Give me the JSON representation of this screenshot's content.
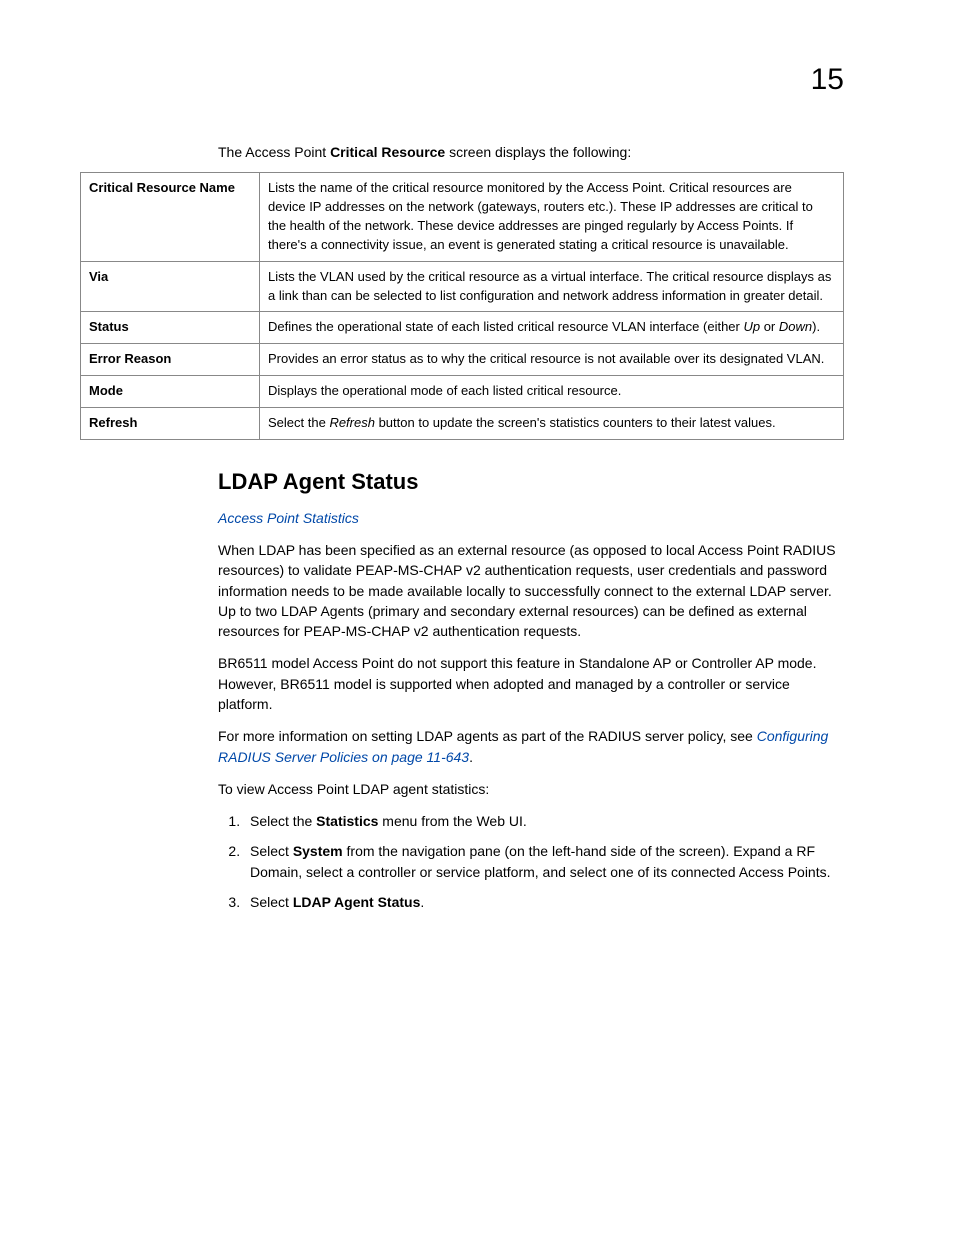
{
  "page_number": "15",
  "intro": {
    "prefix": "The Access Point ",
    "bold": "Critical Resource",
    "suffix": " screen displays the following:"
  },
  "table": [
    {
      "label": "Critical Resource Name",
      "desc": "Lists the name of the critical resource monitored by the Access Point. Critical resources are device IP addresses on the network (gateways, routers etc.). These IP addresses are critical to the health of the network. These device addresses are pinged regularly by Access Points. If there's a connectivity issue, an event is generated stating a critical resource is unavailable."
    },
    {
      "label": "Via",
      "desc": "Lists the VLAN used by the critical resource as a virtual interface. The critical resource displays as a link than can be selected to list configuration and network address information in greater detail."
    },
    {
      "label": "Status",
      "desc_pre": "Defines the operational state of each listed critical resource VLAN interface (either ",
      "ital1": "Up",
      "mid": " or ",
      "ital2": "Down",
      "desc_post": ")."
    },
    {
      "label": "Error Reason",
      "desc": "Provides an error status as to why the critical resource is not available over its designated VLAN."
    },
    {
      "label": "Mode",
      "desc": "Displays the operational mode of each listed critical resource."
    },
    {
      "label": "Refresh",
      "desc_pre": "Select the ",
      "ital1": "Refresh",
      "desc_post": " button to update the screen's statistics counters to their latest values."
    }
  ],
  "section_heading": "LDAP Agent Status",
  "breadcrumb_link": "Access Point Statistics",
  "para1": "When LDAP has been specified as an external resource (as opposed to local Access Point RADIUS resources) to validate PEAP-MS-CHAP v2 authentication requests, user credentials and password information needs to be made available locally to successfully connect to the external LDAP server. Up to two LDAP Agents (primary and secondary external resources) can be defined as external resources for PEAP-MS-CHAP v2 authentication requests.",
  "para2": "BR6511 model Access Point do not support this feature in Standalone AP or Controller AP mode. However, BR6511 model is supported when adopted and managed by a controller or service platform.",
  "para3_pre": "For more information on setting LDAP agents as part of the RADIUS server policy, see ",
  "para3_link": "Configuring RADIUS Server Policies on page 11-643",
  "para3_post": ".",
  "para4": "To view Access Point LDAP agent statistics:",
  "steps": {
    "s1_pre": "Select the ",
    "s1_bold": "Statistics",
    "s1_post": " menu from the Web UI.",
    "s2_pre": "Select ",
    "s2_bold": "System",
    "s2_post": " from the navigation pane (on the left-hand side of the screen). Expand a RF Domain, select a controller or service platform, and select one of its connected Access Points.",
    "s3_pre": "Select ",
    "s3_bold": "LDAP Agent Status",
    "s3_post": "."
  }
}
